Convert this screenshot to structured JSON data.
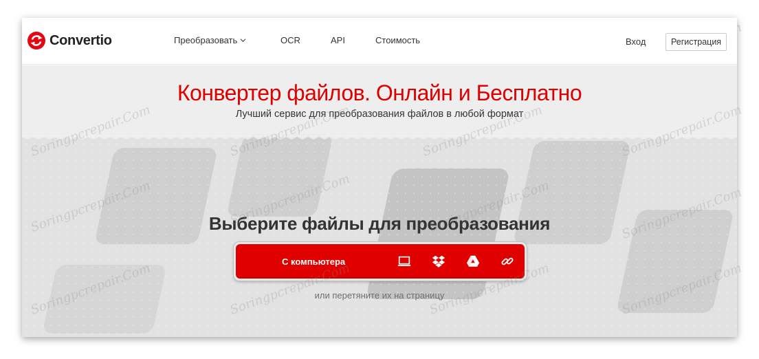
{
  "brand": {
    "name": "Convertio",
    "logo_color": "#e30613"
  },
  "nav": {
    "items": [
      {
        "label": "Преобразовать",
        "has_dropdown": true,
        "icon": "chevron-down-icon"
      },
      {
        "label": "OCR"
      },
      {
        "label": "API"
      },
      {
        "label": "Стоимость"
      }
    ],
    "login_label": "Вход",
    "register_label": "Регистрация"
  },
  "hero": {
    "title": "Конвертер файлов. Онлайн и Бесплатно",
    "subtitle": "Лучший сервис для преобразования файлов в любой формат",
    "title_color": "#dd0000"
  },
  "upload": {
    "heading": "Выберите файлы для преобразования",
    "button_label": "С компьютера",
    "button_color": "#e10000",
    "sources": [
      {
        "name": "computer",
        "icon": "laptop-icon"
      },
      {
        "name": "dropbox",
        "icon": "dropbox-icon"
      },
      {
        "name": "google-drive",
        "icon": "google-drive-icon"
      },
      {
        "name": "url",
        "icon": "link-icon"
      }
    ],
    "drag_hint": "или перетяните их на страницу"
  },
  "watermark": {
    "text": "Soringpcrepair.Com"
  }
}
